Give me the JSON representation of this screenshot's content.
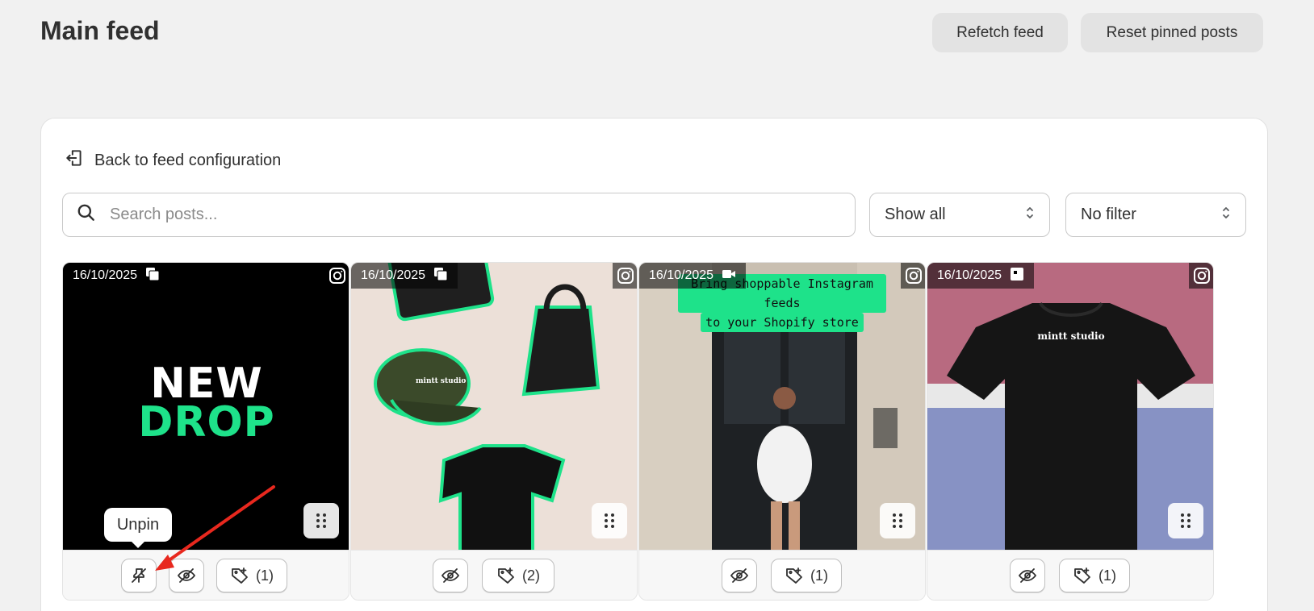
{
  "page": {
    "title": "Main feed"
  },
  "header": {
    "refetch_label": "Refetch feed",
    "reset_label": "Reset pinned posts"
  },
  "back": {
    "label": "Back to feed configuration",
    "icon": "back-exit-icon"
  },
  "search": {
    "placeholder": "Search posts..."
  },
  "filters": {
    "show_value": "Show all",
    "filter_value": "No filter"
  },
  "tooltip": {
    "label": "Unpin"
  },
  "colors": {
    "accent_green": "#1ee28a",
    "arrow_red": "#e8281e"
  },
  "posts": [
    {
      "date": "16/10/2025",
      "type_icon": "carousel-icon",
      "source_icon": "instagram-icon",
      "headline_1": "NEW",
      "headline_2": "DROP",
      "tag_count": "(1)",
      "pinned": true
    },
    {
      "date": "16/10/2025",
      "type_icon": "carousel-icon",
      "source_icon": "instagram-icon",
      "brand": "mintt studio",
      "tag_count": "(2)",
      "pinned": false
    },
    {
      "date": "16/10/2025",
      "type_icon": "video-icon",
      "source_icon": "instagram-icon",
      "caption_1": "Bring shoppable Instagram feeds",
      "caption_2": "to your Shopify store",
      "tag_count": "(1)",
      "pinned": false
    },
    {
      "date": "16/10/2025",
      "type_icon": "image-icon",
      "source_icon": "instagram-icon",
      "brand": "mintt studio",
      "tag_count": "(1)",
      "pinned": false
    }
  ]
}
